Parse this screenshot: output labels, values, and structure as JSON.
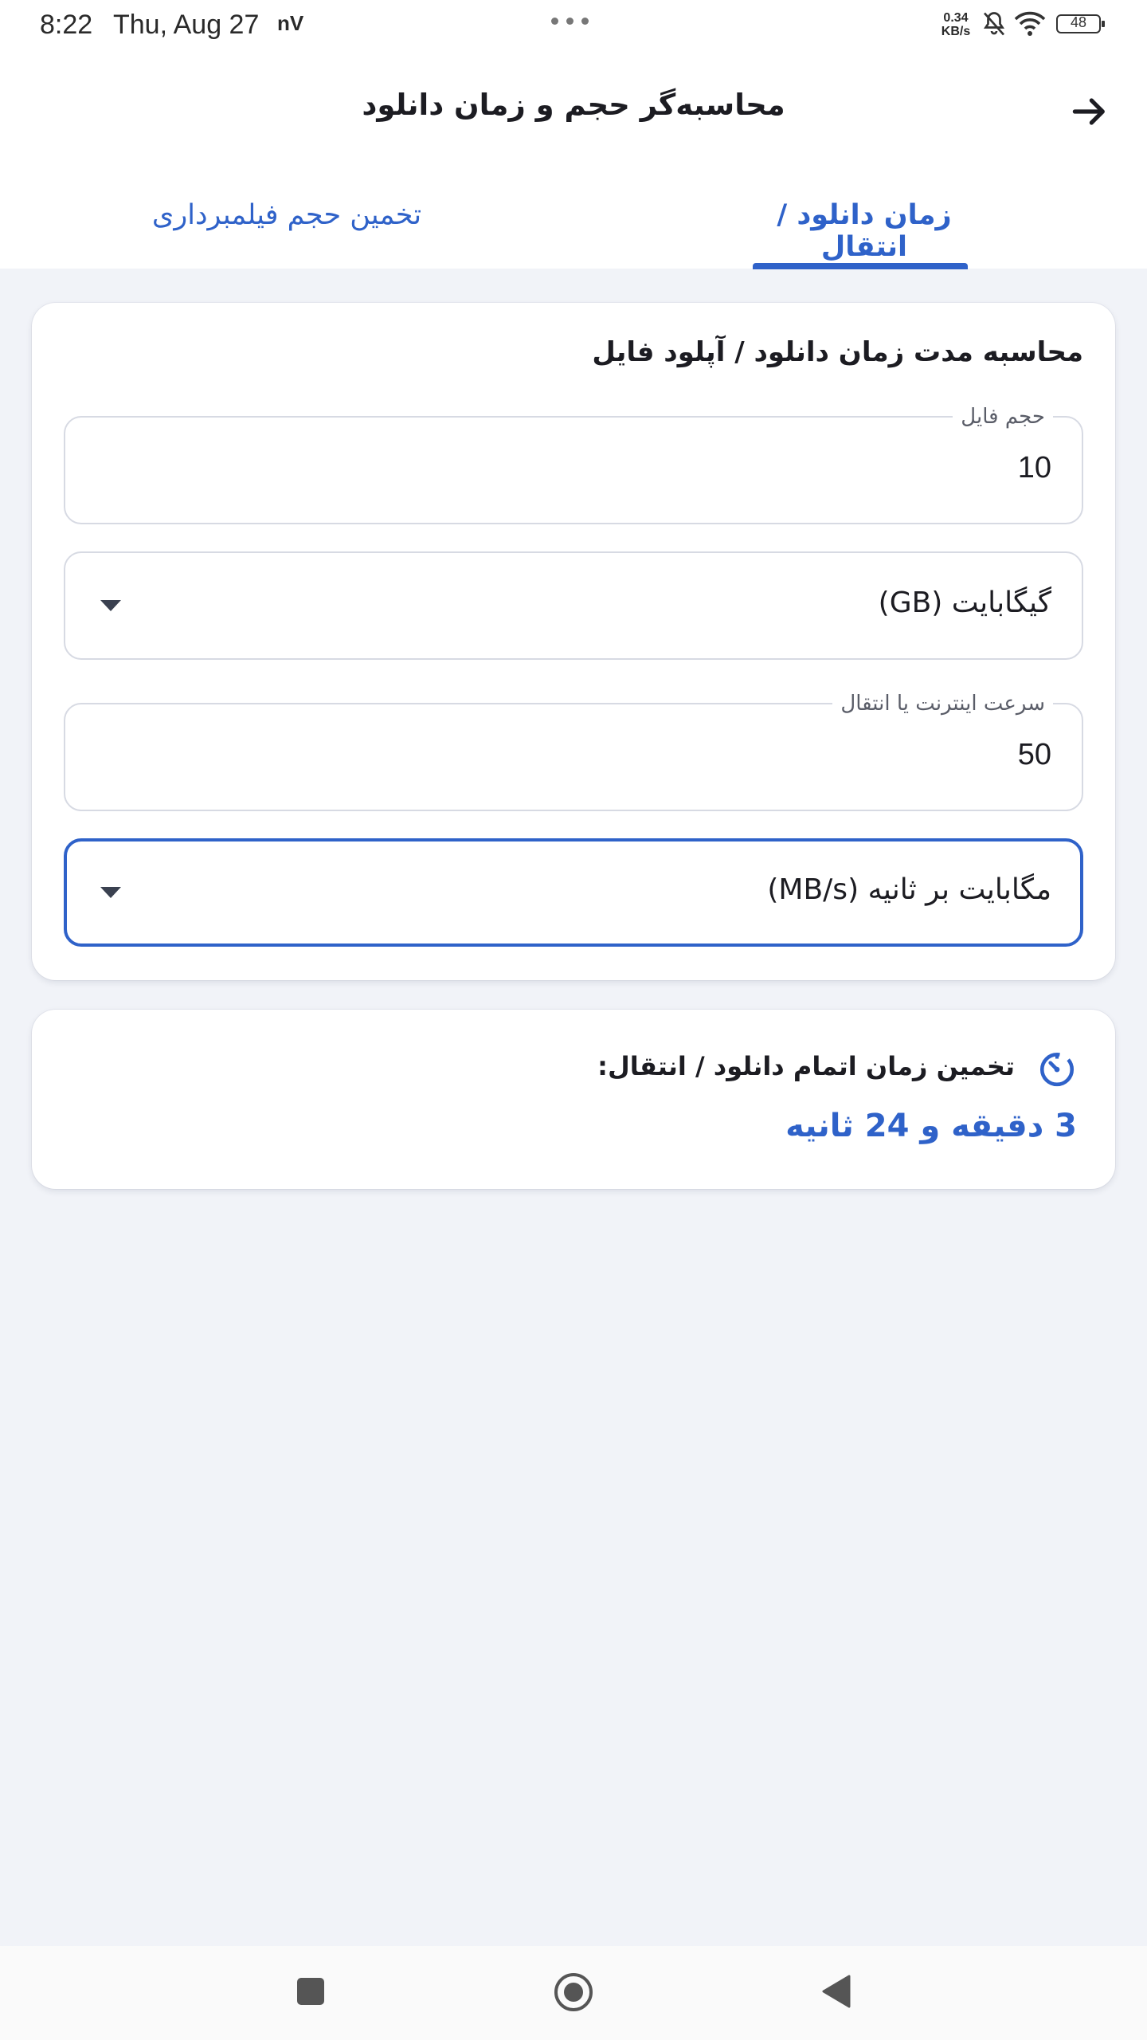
{
  "status_bar": {
    "time": "8:22",
    "date": "Thu, Aug 27",
    "carrier_mark": "nV",
    "net_speed_value": "0.34",
    "net_speed_unit": "KB/s",
    "battery_level": "48",
    "icons": [
      "bell-off-icon",
      "wifi-icon",
      "battery-icon"
    ]
  },
  "app_bar": {
    "title": "محاسبه‌گر حجم و زمان دانلود",
    "back_icon": "arrow-right-icon"
  },
  "tabs": [
    {
      "label": "زمان دانلود / انتقال",
      "active": true
    },
    {
      "label": "تخمین حجم فیلمبرداری",
      "active": false
    }
  ],
  "calculator_card": {
    "title": "محاسبه مدت زمان دانلود / آپلود فایل",
    "file_size": {
      "label": "حجم فایل",
      "value": "10"
    },
    "size_unit": {
      "selected": "گیگابایت (GB)"
    },
    "speed": {
      "label": "سرعت اینترنت یا انتقال",
      "value": "50"
    },
    "speed_unit": {
      "selected": "مگابایت بر ثانیه (MB/s)"
    }
  },
  "result_card": {
    "icon": "timer-icon",
    "label": "تخمین زمان اتمام دانلود / انتقال:",
    "value": "3 دقیقه و 24 ثانیه"
  },
  "nav_bar": {
    "icons": [
      "recents-square-icon",
      "home-circle-icon",
      "back-triangle-icon"
    ]
  },
  "colors": {
    "accent": "#2f62c9",
    "background": "#f1f3f8",
    "card": "#ffffff"
  }
}
